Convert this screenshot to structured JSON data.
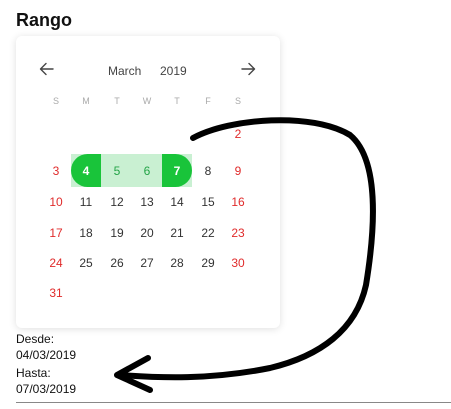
{
  "title": "Rango",
  "calendar": {
    "month": "March",
    "year": "2019",
    "prev_icon": "arrow-left-icon",
    "next_icon": "arrow-right-icon",
    "weekdays": [
      "S",
      "M",
      "T",
      "W",
      "T",
      "F",
      "S"
    ],
    "weeks": [
      [
        "",
        "",
        "",
        "",
        "",
        "",
        "2"
      ],
      [
        "3",
        "4",
        "5",
        "6",
        "7",
        "8",
        "9"
      ],
      [
        "10",
        "11",
        "12",
        "13",
        "14",
        "15",
        "16"
      ],
      [
        "17",
        "18",
        "19",
        "20",
        "21",
        "22",
        "23"
      ],
      [
        "24",
        "25",
        "26",
        "27",
        "28",
        "29",
        "30"
      ],
      [
        "31",
        "",
        "",
        "",
        "",
        "",
        ""
      ]
    ],
    "range_start": "4",
    "range_end": "7",
    "colors": {
      "accent": "#19c43a",
      "range_fill": "#c9f0d2",
      "weekend": "#e02b2b"
    }
  },
  "selection": {
    "from_label": "Desde:",
    "from_value": "04/03/2019",
    "to_label": "Hasta:",
    "to_value": "07/03/2019"
  }
}
